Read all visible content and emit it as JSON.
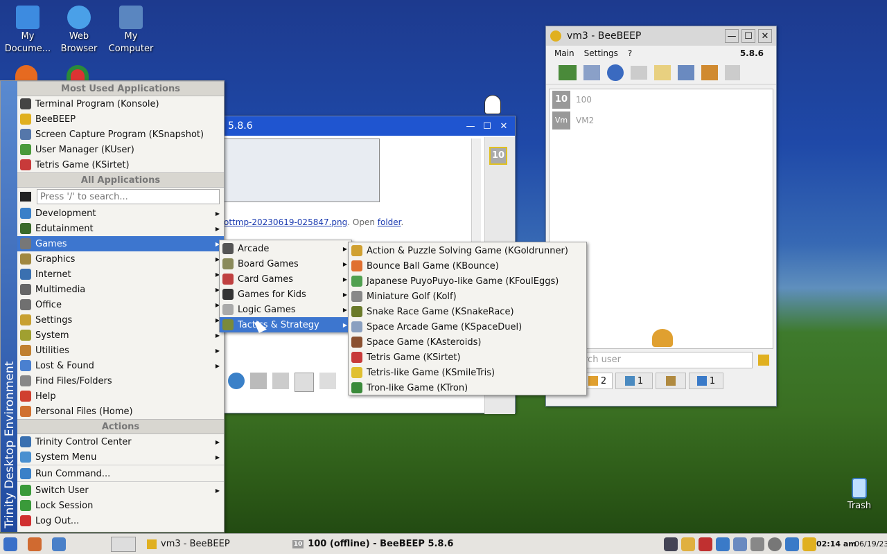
{
  "desktop": {
    "icons": [
      {
        "label": "My\nDocume...",
        "icon": "documents-icon",
        "color": "#3d8be0"
      },
      {
        "label": "Web\nBrowser",
        "icon": "globe-icon",
        "color": "#4aa0e8"
      },
      {
        "label": "My\nComputer",
        "icon": "computer-icon",
        "color": "#5a86c0"
      }
    ],
    "trash_label": "Trash"
  },
  "start_menu": {
    "sidebar_label": "Trinity Desktop Environment",
    "most_used_header": "Most Used Applications",
    "most_used": [
      {
        "label": "Terminal Program (Konsole)",
        "color": "#444"
      },
      {
        "label": "BeeBEEP",
        "color": "#e0b020"
      },
      {
        "label": "Screen Capture Program (KSnapshot)",
        "color": "#5577aa"
      },
      {
        "label": "User Manager (KUser)",
        "color": "#4a9a3a"
      },
      {
        "label": "Tetris Game (KSirtet)",
        "color": "#c83a3a"
      }
    ],
    "all_apps_header": "All Applications",
    "search_placeholder": "Press '/' to search...",
    "categories": [
      {
        "label": "Development",
        "color": "#3a80c8"
      },
      {
        "label": "Edutainment",
        "color": "#3a6a2a"
      },
      {
        "label": "Games",
        "color": "#777"
      },
      {
        "label": "Graphics",
        "color": "#a08840"
      },
      {
        "label": "Internet",
        "color": "#3a70b0"
      },
      {
        "label": "Multimedia",
        "color": "#666"
      },
      {
        "label": "Office",
        "color": "#707070"
      },
      {
        "label": "Settings",
        "color": "#c8a030"
      },
      {
        "label": "System",
        "color": "#a0a030"
      },
      {
        "label": "Utilities",
        "color": "#c08030"
      },
      {
        "label": "Lost & Found",
        "color": "#4a80d0"
      }
    ],
    "other_items": [
      {
        "label": "Find Files/Folders",
        "color": "#888"
      },
      {
        "label": "Help",
        "color": "#d04030"
      },
      {
        "label": "Personal Files (Home)",
        "color": "#d07030"
      }
    ],
    "actions_header": "Actions",
    "actions": [
      {
        "label": "Trinity Control Center",
        "color": "#3a70b0",
        "sub": true
      },
      {
        "label": "System Menu",
        "color": "#4a90d0",
        "sub": true
      },
      {
        "label": "Run Command...",
        "color": "#3a80c8",
        "sub": false
      },
      {
        "label": "Switch User",
        "color": "#3a9a3a",
        "sub": true
      },
      {
        "label": "Lock Session",
        "color": "#3a9a3a",
        "sub": false
      },
      {
        "label": "Log Out...",
        "color": "#d03030",
        "sub": false
      }
    ]
  },
  "games_menu": {
    "items": [
      {
        "label": "Arcade",
        "color": "#555"
      },
      {
        "label": "Board Games",
        "color": "#8a8a5a"
      },
      {
        "label": "Card Games",
        "color": "#c04040"
      },
      {
        "label": "Games for Kids",
        "color": "#333"
      },
      {
        "label": "Logic Games",
        "color": "#aaa"
      },
      {
        "label": "Tactics & Strategy",
        "color": "#7a8a3a"
      }
    ]
  },
  "tactics_menu": {
    "items": [
      {
        "label": "Action & Puzzle Solving Game (KGoldrunner)",
        "color": "#d0a030"
      },
      {
        "label": "Bounce Ball Game (KBounce)",
        "color": "#e07030"
      },
      {
        "label": "Japanese PuyoPuyo-like Game (KFoulEggs)",
        "color": "#50a050"
      },
      {
        "label": "Miniature Golf (Kolf)",
        "color": "#888"
      },
      {
        "label": "Snake Race Game (KSnakeRace)",
        "color": "#6a7a2a"
      },
      {
        "label": "Space Arcade Game (KSpaceDuel)",
        "color": "#8aa0c0"
      },
      {
        "label": "Space Game (KAsteroids)",
        "color": "#8a5030"
      },
      {
        "label": "Tetris Game (KSirtet)",
        "color": "#c83a3a"
      },
      {
        "label": "Tetris-like Game (KSmileTris)",
        "color": "#e0c030"
      },
      {
        "label": "Tron-like Game (KTron)",
        "color": "#3a8a3a"
      }
    ]
  },
  "bg_window": {
    "title_suffix": "5.8.6",
    "file_text": "ottmp-20230619-025847.png",
    "open_text": ". Open ",
    "folder_link": "folder",
    "period": ".",
    "badge": "10"
  },
  "beebeep": {
    "title": "vm3 - BeeBEEP",
    "menu": [
      "Main",
      "Settings",
      "?"
    ],
    "version": "5.8.6",
    "users": [
      {
        "badge": "10",
        "name": "100"
      },
      {
        "badge": "Vm",
        "name": "VM2"
      }
    ],
    "search_placeholder": "rch user",
    "tabs": [
      {
        "count": "2",
        "icon": "users-icon"
      },
      {
        "count": "1",
        "icon": "chat-icon"
      },
      {
        "count": "",
        "icon": "groups-icon"
      },
      {
        "count": "1",
        "icon": "share-icon"
      }
    ]
  },
  "taskbar": {
    "tasks": [
      {
        "label": "vm3 - BeeBEEP"
      },
      {
        "label": "100 (offline) - BeeBEEP 5.8.6",
        "badge": "10"
      }
    ],
    "time": "02:14 am",
    "date": "06/19/23"
  },
  "colors": {
    "menu_highlight": "#3d76cf",
    "titlebar": "#c9d3e6"
  }
}
